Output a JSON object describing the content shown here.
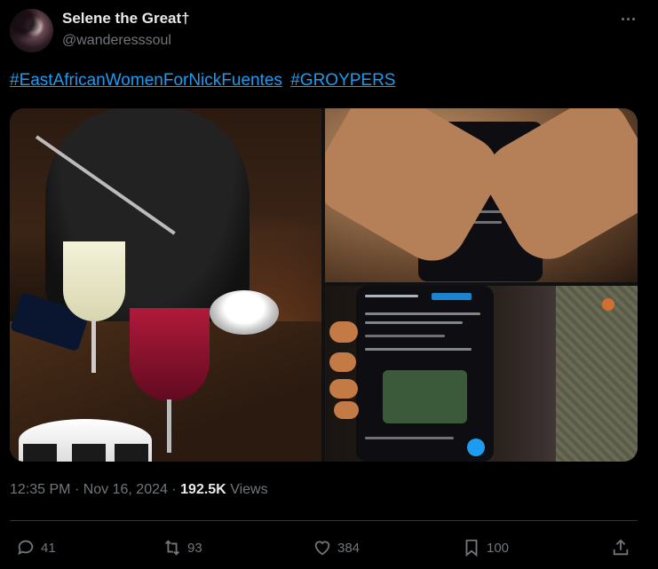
{
  "author": {
    "name": "Selene the Great†",
    "handle": "@wanderesssoul"
  },
  "tweet": {
    "hashtags": [
      "#EastAfricanWomenForNickFuentes",
      "#GROYPERS"
    ]
  },
  "media": {
    "count": 3,
    "photos": [
      "dinner-table-drinks-photo",
      "hands-heart-over-phone-photo",
      "hand-holding-phone-photo"
    ]
  },
  "meta": {
    "time": "12:35 PM",
    "separator": "·",
    "date": "Nov 16, 2024",
    "views_count": "192.5K",
    "views_label": "Views"
  },
  "actions": {
    "replies": "41",
    "reposts": "93",
    "likes": "384",
    "bookmarks": "100"
  },
  "colors": {
    "accent": "#1d9bf0",
    "muted": "#71767b",
    "text": "#e7e9ea",
    "background": "#000000"
  }
}
